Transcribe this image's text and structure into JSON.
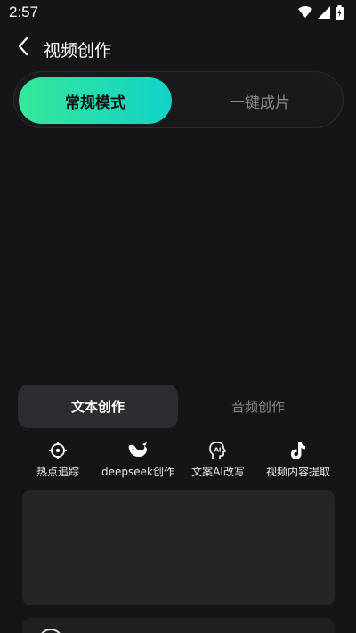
{
  "status_bar": {
    "time": "2:57",
    "icons": [
      "wifi-icon",
      "signal-icon",
      "battery-icon"
    ]
  },
  "header": {
    "title": "视频创作",
    "back_icon": "chevron-left-icon"
  },
  "mode_switch": {
    "active_label": "常规模式",
    "inactive_label": "一键成片",
    "active_gradient": [
      "#35e89a",
      "#12d2c8"
    ]
  },
  "creation_tabs": {
    "active_label": "文本创作",
    "inactive_label": "音频创作"
  },
  "tools": [
    {
      "label": "热点追踪",
      "icon": "crosshair-icon"
    },
    {
      "label": "deepseek创作",
      "icon": "whale-icon"
    },
    {
      "label": "文案AI改写",
      "icon": "ai-head-icon"
    },
    {
      "label": "视频内容提取",
      "icon": "tiktok-icon"
    }
  ],
  "colors": {
    "background": "#151517",
    "panel": "#252528",
    "accent": "#1fdcb4"
  }
}
